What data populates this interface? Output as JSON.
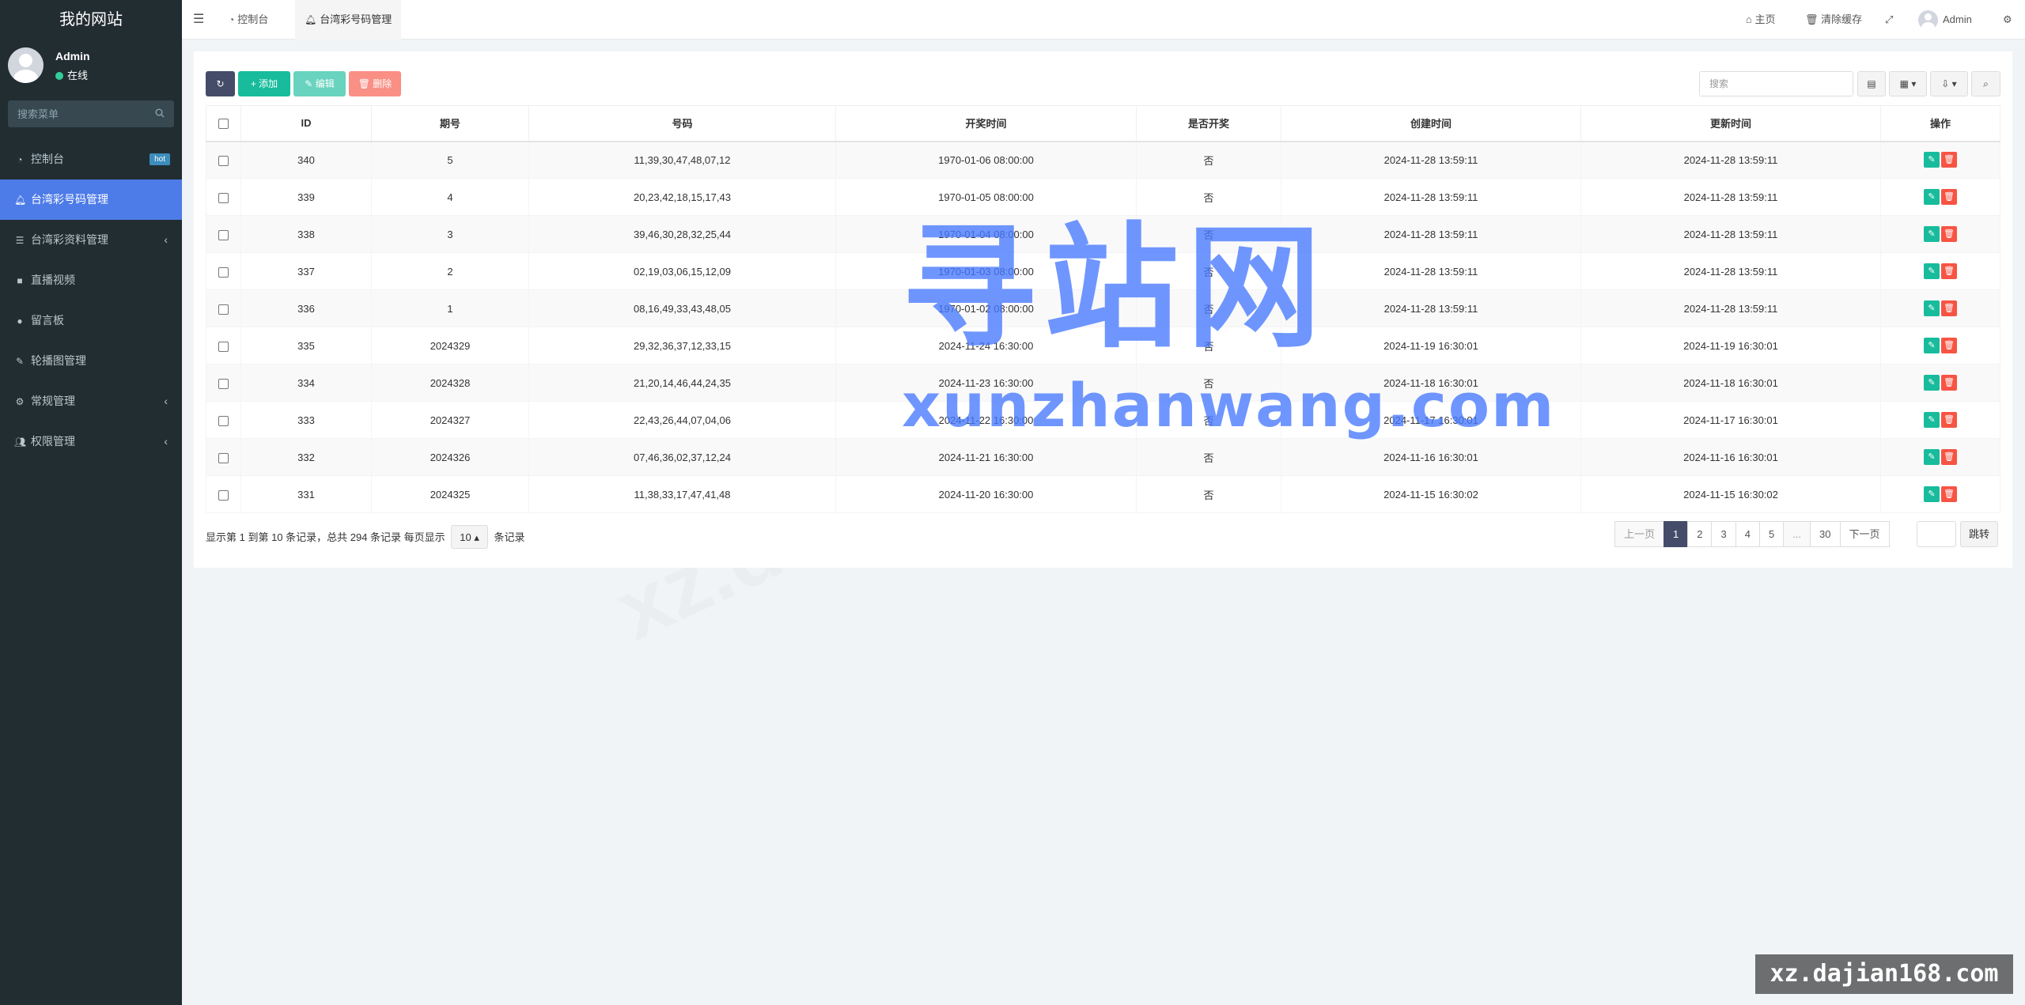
{
  "sidebar": {
    "logo": "我的网站",
    "user_name": "Admin",
    "user_status": "在线",
    "search_placeholder": "搜索菜单",
    "items": [
      {
        "label": "控制台",
        "badge": "hot"
      },
      {
        "label": "台湾彩号码管理"
      },
      {
        "label": "台湾彩资料管理"
      },
      {
        "label": "直播视频"
      },
      {
        "label": "留言板"
      },
      {
        "label": "轮播图管理"
      },
      {
        "label": "常规管理"
      },
      {
        "label": "权限管理"
      }
    ]
  },
  "header": {
    "tabs": [
      "控制台",
      "台湾彩号码管理"
    ],
    "home": "主页",
    "clear_cache": "清除缓存",
    "admin": "Admin"
  },
  "toolbar": {
    "add": "添加",
    "edit": "编辑",
    "delete": "删除",
    "search_placeholder": "搜索"
  },
  "table": {
    "headers": [
      "ID",
      "期号",
      "号码",
      "开奖时间",
      "是否开奖",
      "创建时间",
      "更新时间",
      "操作"
    ],
    "rows": [
      [
        "340",
        "5",
        "11,39,30,47,48,07,12",
        "1970-01-06 08:00:00",
        "否",
        "2024-11-28 13:59:11",
        "2024-11-28 13:59:11"
      ],
      [
        "339",
        "4",
        "20,23,42,18,15,17,43",
        "1970-01-05 08:00:00",
        "否",
        "2024-11-28 13:59:11",
        "2024-11-28 13:59:11"
      ],
      [
        "338",
        "3",
        "39,46,30,28,32,25,44",
        "1970-01-04 08:00:00",
        "否",
        "2024-11-28 13:59:11",
        "2024-11-28 13:59:11"
      ],
      [
        "337",
        "2",
        "02,19,03,06,15,12,09",
        "1970-01-03 08:00:00",
        "否",
        "2024-11-28 13:59:11",
        "2024-11-28 13:59:11"
      ],
      [
        "336",
        "1",
        "08,16,49,33,43,48,05",
        "1970-01-02 08:00:00",
        "否",
        "2024-11-28 13:59:11",
        "2024-11-28 13:59:11"
      ],
      [
        "335",
        "2024329",
        "29,32,36,37,12,33,15",
        "2024-11-24 16:30:00",
        "否",
        "2024-11-19 16:30:01",
        "2024-11-19 16:30:01"
      ],
      [
        "334",
        "2024328",
        "21,20,14,46,44,24,35",
        "2024-11-23 16:30:00",
        "否",
        "2024-11-18 16:30:01",
        "2024-11-18 16:30:01"
      ],
      [
        "333",
        "2024327",
        "22,43,26,44,07,04,06",
        "2024-11-22 16:30:00",
        "否",
        "2024-11-17 16:30:01",
        "2024-11-17 16:30:01"
      ],
      [
        "332",
        "2024326",
        "07,46,36,02,37,12,24",
        "2024-11-21 16:30:00",
        "否",
        "2024-11-16 16:30:01",
        "2024-11-16 16:30:01"
      ],
      [
        "331",
        "2024325",
        "11,38,33,17,47,41,48",
        "2024-11-20 16:30:00",
        "否",
        "2024-11-15 16:30:02",
        "2024-11-15 16:30:02"
      ]
    ]
  },
  "footer": {
    "info": "显示第 1 到第 10 条记录，总共 294 条记录 每页显示",
    "page_size": "10",
    "suffix": "条记录"
  },
  "pagination": {
    "prev": "上一页",
    "pages": [
      "1",
      "2",
      "3",
      "4",
      "5",
      "...",
      "30"
    ],
    "next": "下一页",
    "jump": "跳转"
  },
  "watermark": {
    "big": "寻站网",
    "url": "xunzhanwang.com",
    "corner": "xz.dajian168.com",
    "faint": "xz.dajian"
  }
}
